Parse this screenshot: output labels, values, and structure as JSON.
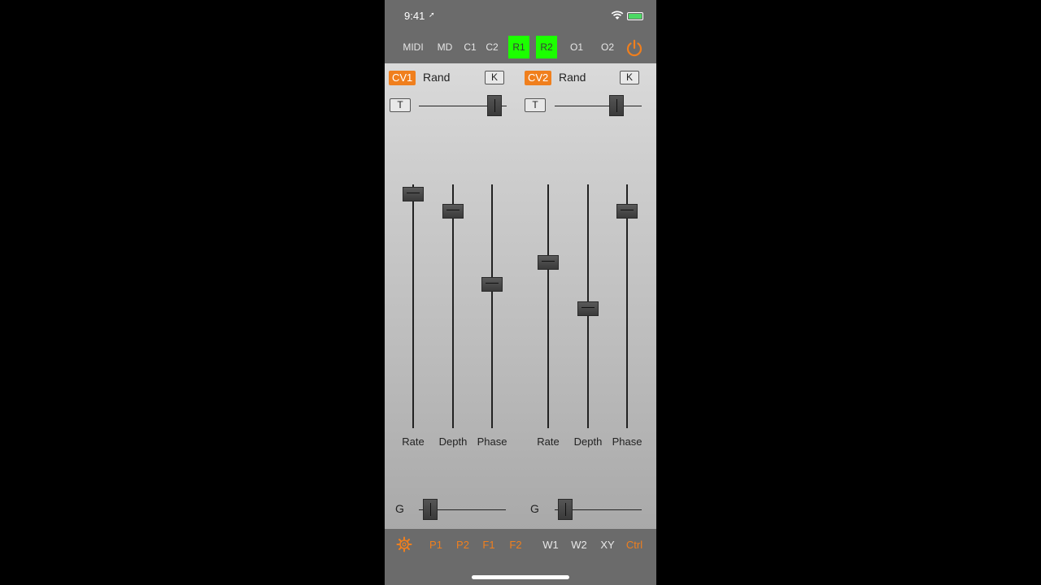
{
  "status_bar": {
    "time": "9:41"
  },
  "top_nav": [
    {
      "label": "MIDI",
      "active": false
    },
    {
      "label": "MD",
      "active": false
    },
    {
      "label": "C1",
      "active": false
    },
    {
      "label": "C2",
      "active": false
    },
    {
      "label": "R1",
      "active": true
    },
    {
      "label": "R2",
      "active": true
    },
    {
      "label": "O1",
      "active": false
    },
    {
      "label": "O2",
      "active": false
    }
  ],
  "colors": {
    "accent": "#f07f1d",
    "active_green": "#1cff00"
  },
  "channels": [
    {
      "tag": "CV1",
      "type": "Rand",
      "key_label": "K",
      "t_label": "T",
      "g_label": "G",
      "t_level": 0.93,
      "g_level": 0.05,
      "faders": [
        {
          "label": "Rate",
          "level": 0.98
        },
        {
          "label": "Depth",
          "level": 0.91
        },
        {
          "label": "Phase",
          "level": 0.61
        }
      ]
    },
    {
      "tag": "CV2",
      "type": "Rand",
      "key_label": "K",
      "t_label": "T",
      "g_label": "G",
      "t_level": 0.75,
      "g_level": 0.05,
      "faders": [
        {
          "label": "Rate",
          "level": 0.7
        },
        {
          "label": "Depth",
          "level": 0.51
        },
        {
          "label": "Phase",
          "level": 0.91
        }
      ]
    }
  ],
  "bottom_nav": [
    {
      "label": "P1",
      "color": "orange"
    },
    {
      "label": "P2",
      "color": "orange"
    },
    {
      "label": "F1",
      "color": "orange"
    },
    {
      "label": "F2",
      "color": "orange"
    },
    {
      "label": "W1",
      "color": "white"
    },
    {
      "label": "W2",
      "color": "white"
    },
    {
      "label": "XY",
      "color": "white"
    },
    {
      "label": "Ctrl",
      "color": "orange"
    }
  ]
}
